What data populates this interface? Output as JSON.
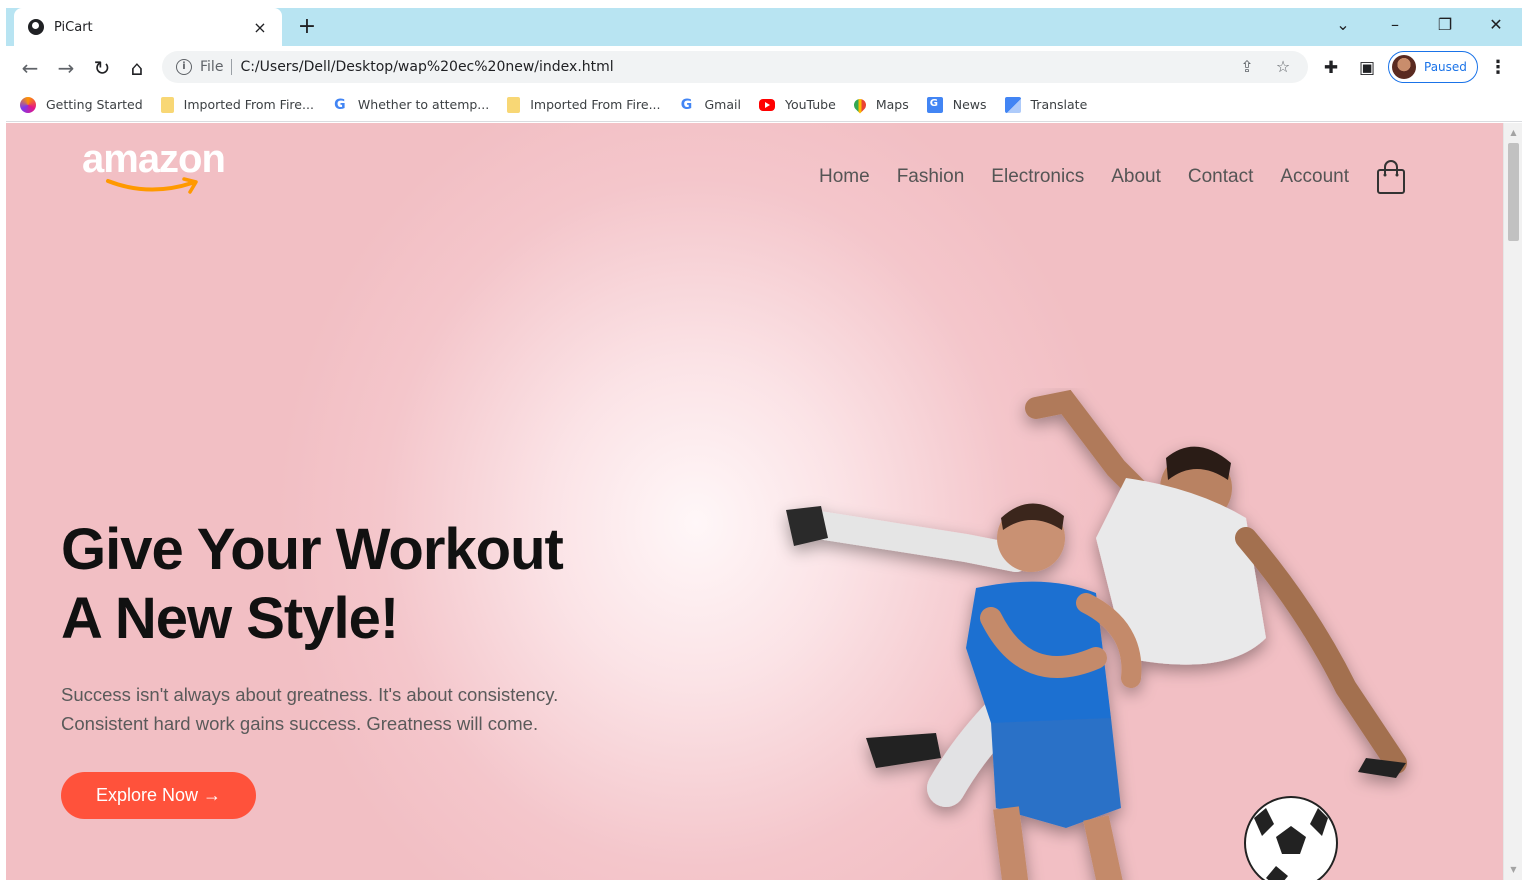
{
  "browser": {
    "tab_title": "PiCart",
    "tab_close": "×",
    "new_tab": "+",
    "window_controls": {
      "tab_search": "⌄",
      "minimize": "–",
      "restore": "❐",
      "close": "✕"
    },
    "address": {
      "scheme": "File",
      "url": "C:/Users/Dell/Desktop/wap%20ec%20new/index.html"
    },
    "profile_label": "Paused",
    "bookmarks": [
      {
        "label": "Getting Started",
        "icon": "firefox-icon"
      },
      {
        "label": "Imported From Fire...",
        "icon": "folder-icon"
      },
      {
        "label": "Whether to attemp...",
        "icon": "google-icon"
      },
      {
        "label": "Imported From Fire...",
        "icon": "folder-icon"
      },
      {
        "label": "Gmail",
        "icon": "google-icon"
      },
      {
        "label": "YouTube",
        "icon": "youtube-icon"
      },
      {
        "label": "Maps",
        "icon": "maps-icon"
      },
      {
        "label": "News",
        "icon": "news-icon"
      },
      {
        "label": "Translate",
        "icon": "translate-icon"
      }
    ]
  },
  "site": {
    "logo_text": "amazon",
    "nav": [
      "Home",
      "Fashion",
      "Electronics",
      "About",
      "Contact",
      "Account"
    ],
    "hero": {
      "title_line1": "Give Your Workout",
      "title_line2": "A New Style!",
      "subtitle_line1": "Success isn't always about greatness. It's about consistency.",
      "subtitle_line2": "Consistent hard work gains success. Greatness will come.",
      "cta": "Explore Now →"
    },
    "colors": {
      "accent": "#ff523b",
      "background": "#f4c6cb",
      "text_dark": "#111111",
      "logo_smile": "#ff9900"
    }
  }
}
